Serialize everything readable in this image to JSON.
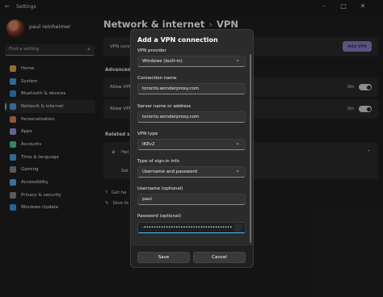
{
  "window": {
    "title": "Settings",
    "back_glyph": "←",
    "min_glyph": "–",
    "max_glyph": "□",
    "close_glyph": "✕"
  },
  "sidebar": {
    "user_name": "paul reinheimer",
    "search_placeholder": "Find a setting",
    "items": [
      {
        "label": "Home",
        "color": "#e8a44a"
      },
      {
        "label": "System",
        "color": "#4aa3e8"
      },
      {
        "label": "Bluetooth & devices",
        "color": "#3b8fd9"
      },
      {
        "label": "Network & internet",
        "color": "#5aa0e0"
      },
      {
        "label": "Personalization",
        "color": "#d8885a"
      },
      {
        "label": "Apps",
        "color": "#9a9ae8"
      },
      {
        "label": "Accounts",
        "color": "#4ad0a0"
      },
      {
        "label": "Time & language",
        "color": "#4aa3e8"
      },
      {
        "label": "Gaming",
        "color": "#8a8a8a"
      },
      {
        "label": "Accessibility",
        "color": "#5ab0f0"
      },
      {
        "label": "Privacy & security",
        "color": "#8a8a9a"
      },
      {
        "label": "Windows Update",
        "color": "#3a9ae8"
      }
    ],
    "active_index": 3
  },
  "main": {
    "breadcrumb_parent": "Network & internet",
    "breadcrumb_sep": "›",
    "breadcrumb_current": "VPN",
    "vpn_row_label": "VPN conn",
    "add_vpn_label": "Add VPN",
    "advanced_label": "Advanced se",
    "allow1_label": "Allow VPN",
    "allow1_state": "On",
    "allow2_label": "Allow VPN",
    "allow2_state": "On",
    "related_label": "Related supp",
    "help_label": "Hel",
    "setup_label": "Set",
    "get_help_label": "Get he",
    "give_feedback_label": "Give fe"
  },
  "dialog": {
    "title": "Add a VPN connection",
    "provider_label": "VPN provider",
    "provider_value": "Windows (built-in)",
    "conn_name_label": "Connection name",
    "conn_name_value": "toronto.wonderproxy.com",
    "server_label": "Server name or address",
    "server_value": "toronto.wonderproxy.com",
    "vpn_type_label": "VPN type",
    "vpn_type_value": "IKEv2",
    "signin_label": "Type of sign-in info",
    "signin_value": "Username and password",
    "username_label": "Username (optional)",
    "username_value": "paul",
    "password_label": "Password (optional)",
    "password_value": "·••••••••••••••••••••••••••••••••••••",
    "save_label": "Save",
    "cancel_label": "Cancel"
  }
}
